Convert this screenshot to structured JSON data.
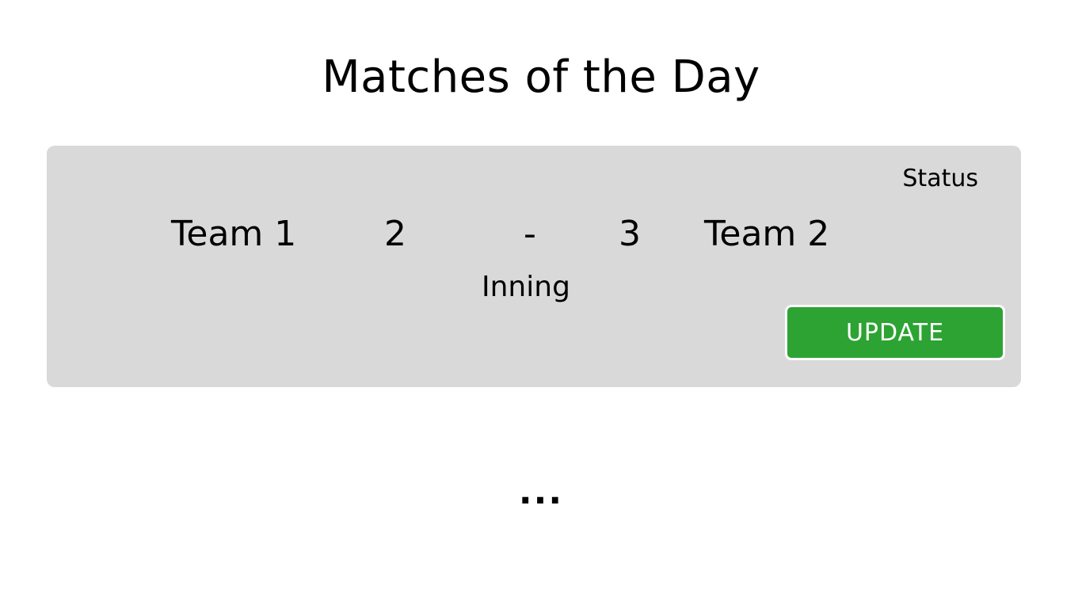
{
  "page": {
    "title": "Matches of the Day",
    "more_indicator": "..."
  },
  "match": {
    "status": "Status",
    "team1": "Team 1",
    "team1_score": "2",
    "separator": "-",
    "team2_score": "3",
    "team2": "Team 2",
    "inning": "Inning",
    "update_label": "UPDATE"
  },
  "colors": {
    "card_background": "#d9d9d9",
    "update_button": "#2ca332"
  }
}
